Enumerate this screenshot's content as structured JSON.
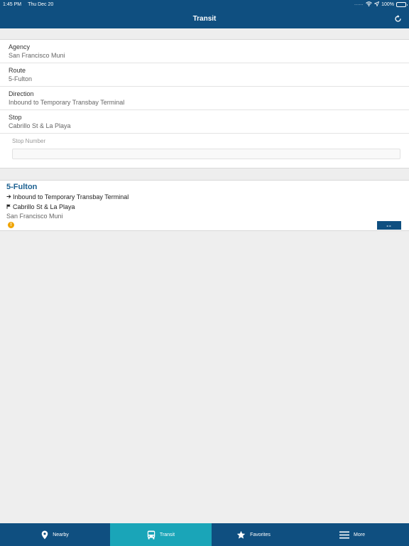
{
  "status_bar": {
    "time": "1:45 PM",
    "date": "Thu Dec 20",
    "signal": "......",
    "battery": "100%"
  },
  "nav": {
    "title": "Transit",
    "refresh_icon": "refresh-icon"
  },
  "form": {
    "agency": {
      "label": "Agency",
      "value": "San Francisco Muni"
    },
    "route": {
      "label": "Route",
      "value": "5-Fulton"
    },
    "direction": {
      "label": "Direction",
      "value": "Inbound to Temporary Transbay Terminal"
    },
    "stop": {
      "label": "Stop",
      "value": "Cabrillo St & La Playa"
    },
    "stop_number": {
      "label": "Stop Number",
      "value": "",
      "placeholder": ""
    }
  },
  "result": {
    "route": "5-Fulton",
    "direction": "Inbound to Temporary Transbay Terminal",
    "stop": "Cabrillo St & La Playa",
    "agency": "San Francisco Muni",
    "alert_icon": "alert-icon",
    "eta": "--"
  },
  "tabs": [
    {
      "label": "Nearby",
      "icon": "location-pin-icon"
    },
    {
      "label": "Transit",
      "icon": "bus-icon",
      "active": true
    },
    {
      "label": "Favorites",
      "icon": "star-icon"
    },
    {
      "label": "More",
      "icon": "menu-icon"
    }
  ],
  "colors": {
    "bar": "#0f4f80",
    "tab_active": "#1aa5b8",
    "route_title": "#1a5f90",
    "alert": "#f0a500"
  }
}
